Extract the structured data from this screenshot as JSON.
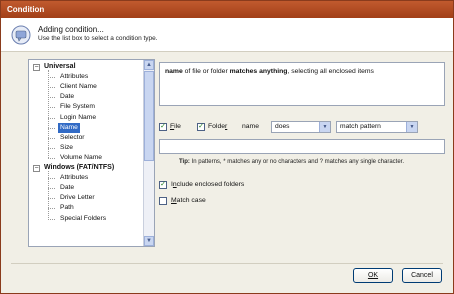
{
  "window": {
    "title": "Condition"
  },
  "header": {
    "icon": "condition-icon",
    "title": "Adding condition...",
    "subtitle": "Use the list box to select a condition type."
  },
  "tree": {
    "groups": [
      {
        "label": "Universal",
        "expanded": true,
        "items": [
          "Attributes",
          "Client Name",
          "Date",
          "File System",
          "Login Name",
          "Name",
          "Selector",
          "Size",
          "Volume Name"
        ]
      },
      {
        "label": "Windows (FAT/NTFS)",
        "expanded": true,
        "items": [
          "Attributes",
          "Date",
          "Drive Letter",
          "Path",
          "Special Folders"
        ]
      }
    ],
    "selected": "Name"
  },
  "description": {
    "part1": "name",
    "part2": " of file or folder ",
    "part3": "matches anything",
    "part4": ", selecting all enclosed items"
  },
  "filters": {
    "file_label": "File",
    "file_checked": true,
    "folder_label": "Folder",
    "folder_checked": true,
    "name_label": "name",
    "operator_value": "does",
    "match_value": "match pattern",
    "pattern_value": ""
  },
  "tip": {
    "bold": "Tip:",
    "text": " In patterns, * matches any or no characters and ? matches any single character."
  },
  "options": {
    "include_label": "Include enclosed folders",
    "include_checked": true,
    "matchcase_label": "Match case",
    "matchcase_checked": false
  },
  "buttons": {
    "ok": "OK",
    "cancel": "Cancel"
  },
  "colors": {
    "titlebar": "#b34c22",
    "selection": "#316ac5",
    "check": "#1a7a1a"
  }
}
